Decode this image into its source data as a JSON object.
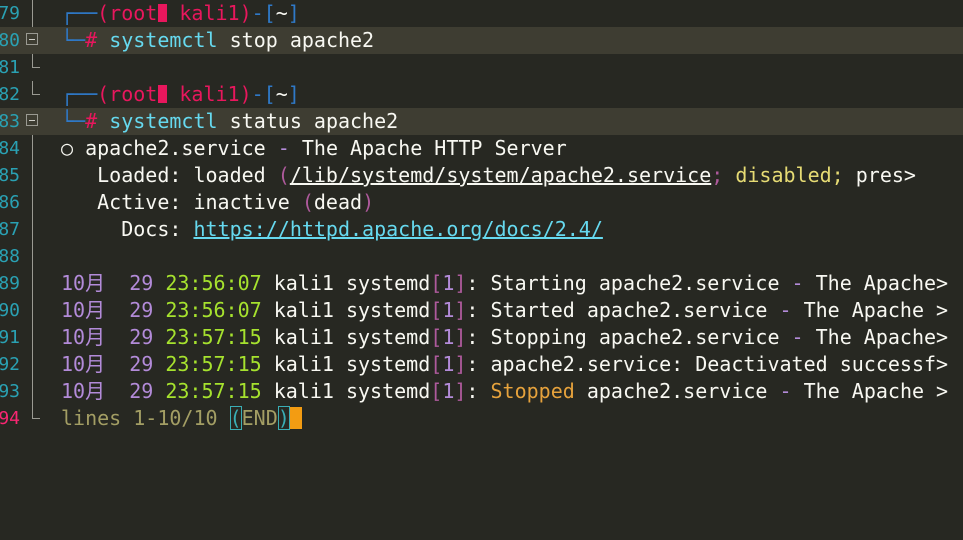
{
  "terminal": {
    "lines": [
      {
        "num": "79",
        "prompt_top": "┌──",
        "user": "(root",
        "host": "kali1)",
        "sep": "-[",
        "dir": "~",
        "close": "]"
      },
      {
        "num": "80",
        "prompt_bottom": "└─",
        "hash": "#",
        "cmd": "systemctl",
        "args": "stop apache2"
      },
      {
        "num": "81"
      },
      {
        "num": "82",
        "prompt_top": "┌──",
        "user": "(root",
        "host": "kali1)",
        "sep": "-[",
        "dir": "~",
        "close": "]"
      },
      {
        "num": "83",
        "prompt_bottom": "└─",
        "hash": "#",
        "cmd": "systemctl",
        "args": "status apache2"
      },
      {
        "num": "84",
        "bullet": "○",
        "service": "apache2.service",
        "dash": "-",
        "desc": "The Apache HTTP Server"
      },
      {
        "num": "85",
        "label": "Loaded:",
        "v1": "loaded",
        "lp": "(",
        "path": "/lib/systemd/system/apache2.service",
        "semi": ";",
        "disabled": "disabled;",
        "trunc": "pres>"
      },
      {
        "num": "86",
        "label": "Active:",
        "v1": "inactive",
        "lp": "(",
        "dead": "dead",
        "rp": ")"
      },
      {
        "num": "87",
        "label": "Docs:",
        "url": "https://httpd.apache.org/docs/2.4/"
      },
      {
        "num": "88"
      },
      {
        "num": "89",
        "month": "10月",
        "day": "29",
        "time": "23:56:07",
        "host": "kali1",
        "proc": "systemd",
        "pid": "1",
        "msg": "Starting apache2.service",
        "dash": "-",
        "tail": "The Apache>"
      },
      {
        "num": "90",
        "month": "10月",
        "day": "29",
        "time": "23:56:07",
        "host": "kali1",
        "proc": "systemd",
        "pid": "1",
        "msg": "Started apache2.service",
        "dash": "-",
        "tail": "The Apache >"
      },
      {
        "num": "91",
        "month": "10月",
        "day": "29",
        "time": "23:57:15",
        "host": "kali1",
        "proc": "systemd",
        "pid": "1",
        "msg": "Stopping apache2.service",
        "dash": "-",
        "tail": "The Apache>"
      },
      {
        "num": "92",
        "month": "10月",
        "day": "29",
        "time": "23:57:15",
        "host": "kali1",
        "proc": "systemd",
        "pid": "1",
        "msg": "apache2.service",
        "colon": ":",
        "tail": "Deactivated successf>"
      },
      {
        "num": "93",
        "month": "10月",
        "day": "29",
        "time": "23:57:15",
        "host": "kali1",
        "proc": "systemd",
        "pid": "1",
        "msg_stopped": "Stopped",
        "msg": "apache2.service",
        "dash": "-",
        "tail": "The Apache >"
      },
      {
        "num": "94",
        "pager": "lines 1-10/10",
        "end_open": "(",
        "end": "END",
        "end_close": ")"
      }
    ]
  },
  "colors": {
    "background": "#272822",
    "line_number": "#2aa1b3",
    "active_line_number": "#f92672",
    "current_line": "#3e3d32",
    "cursor": "#f39c12"
  }
}
